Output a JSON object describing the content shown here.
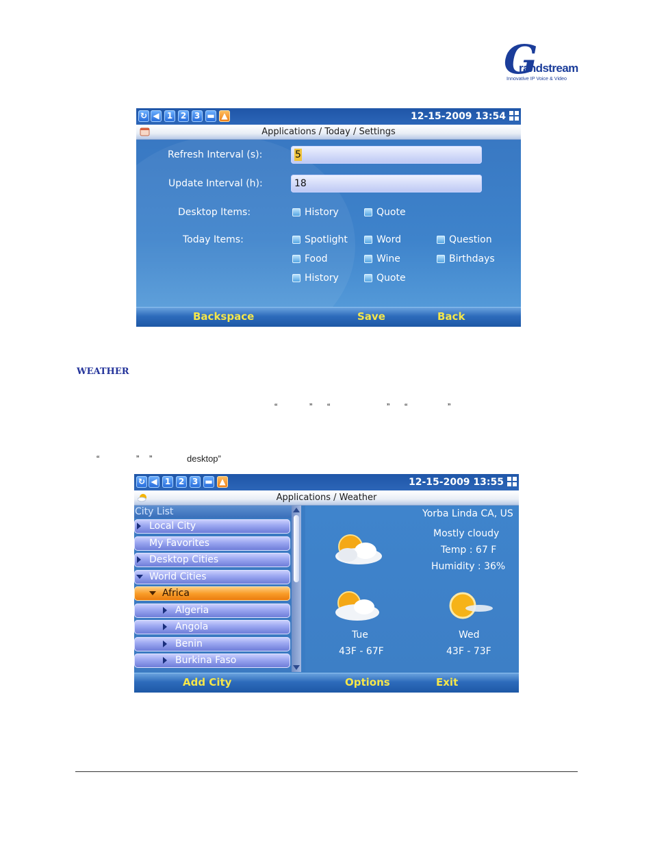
{
  "logo": {
    "letter": "G",
    "word": "randstream",
    "tagline": "Innovative IP Voice & Video"
  },
  "screen1": {
    "status_icons": [
      "1",
      "2",
      "3"
    ],
    "datetime": "12-15-2009 13:54",
    "title": "Applications / Today / Settings",
    "refresh_label": "Refresh Interval (s):",
    "refresh_value": "5",
    "update_label": "Update Interval (h):",
    "update_value": "18",
    "desktop_label": "Desktop Items:",
    "desktop_items": [
      "History",
      "Quote"
    ],
    "today_label": "Today Items:",
    "today_items": [
      "Spotlight",
      "Word",
      "Question",
      "Food",
      "Wine",
      "Birthdays",
      "History",
      "Quote"
    ],
    "softkeys": [
      "Backspace",
      "Save",
      "Back"
    ]
  },
  "document": {
    "heading": "WEATHER",
    "line1_quotes": [
      "“",
      "”",
      "“",
      "”",
      "“",
      "”"
    ],
    "line2_open": "“",
    "line2_close1": "”",
    "line2_close2": "”",
    "line2_text": "desktop”"
  },
  "screen2": {
    "status_icons": [
      "1",
      "2",
      "3"
    ],
    "datetime": "12-15-2009 13:55",
    "title": "Applications / Weather",
    "list_header": "City List",
    "list_items": [
      "Local City",
      "My Favorites",
      "Desktop Cities",
      "World Cities",
      "Africa",
      "Algeria",
      "Angola",
      "Benin",
      "Burkina Faso"
    ],
    "location": "Yorba Linda CA, US",
    "condition": "Mostly cloudy",
    "temp": "Temp : 67 F",
    "humidity": "Humidity : 36%",
    "forecast": [
      {
        "day": "Tue",
        "range": "43F - 67F"
      },
      {
        "day": "Wed",
        "range": "43F - 73F"
      }
    ],
    "softkeys": [
      "Add City",
      "Options",
      "Exit"
    ]
  }
}
